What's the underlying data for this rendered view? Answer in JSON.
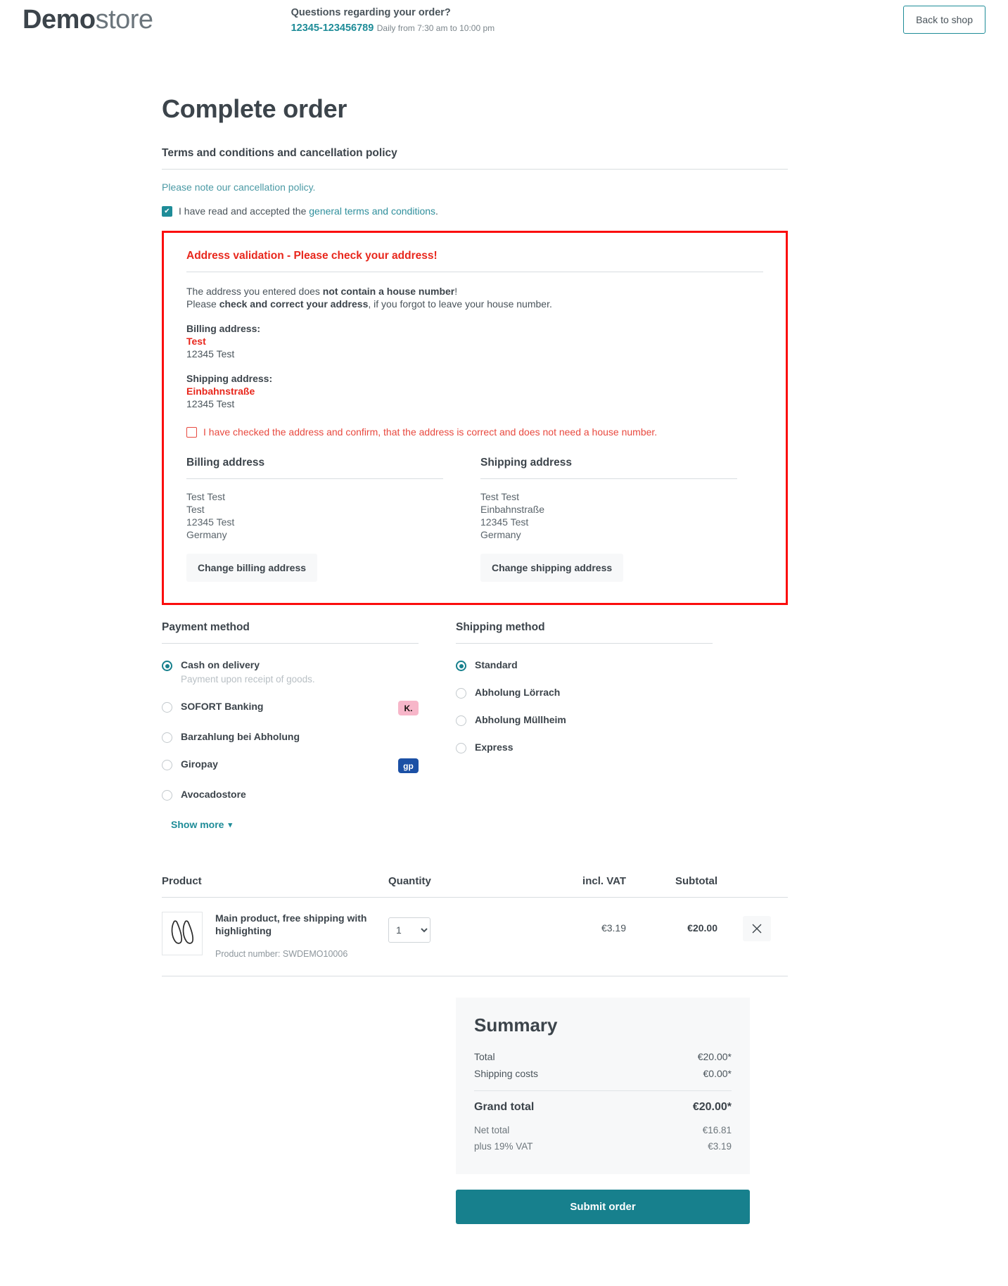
{
  "header": {
    "logo_bold": "Demo",
    "logo_light": "store",
    "question": "Questions regarding your order?",
    "phone": "12345-123456789",
    "hours": "Daily from 7:30 am to 10:00 pm",
    "back_to_shop": "Back to shop"
  },
  "page": {
    "title": "Complete order"
  },
  "terms": {
    "heading": "Terms and conditions and cancellation policy",
    "cancellation_note": "Please note our cancellation policy.",
    "accept_prefix": "I have read and accepted the ",
    "accept_link": "general terms and conditions",
    "accept_suffix": ".",
    "accepted": true
  },
  "validation": {
    "title": "Address validation - Please check your address!",
    "line1_a": "The address you entered does ",
    "line1_b": "not contain a house number",
    "line1_c": "!",
    "line2_a": "Please ",
    "line2_b": "check and correct your address",
    "line2_c": ", if you forgot to leave your house number.",
    "billing_label": "Billing address:",
    "billing_bad": "Test",
    "billing_city": "12345 Test",
    "shipping_label": "Shipping address:",
    "shipping_bad": "Einbahnstraße",
    "shipping_city": "12345 Test",
    "confirm_label": "I have checked the address and confirm, that the address is correct and does not need a house number.",
    "confirm_checked": false,
    "border_color": "#fb0d0d",
    "title_color": "#e8271c"
  },
  "addresses": {
    "billing": {
      "heading": "Billing address",
      "lines": [
        "Test Test",
        "Test",
        "12345 Test",
        "Germany"
      ],
      "change_button": "Change billing address"
    },
    "shipping": {
      "heading": "Shipping address",
      "lines": [
        "Test Test",
        "Einbahnstraße",
        "12345 Test",
        "Germany"
      ],
      "change_button": "Change shipping address"
    }
  },
  "payment": {
    "heading": "Payment method",
    "options": [
      {
        "label": "Cash on delivery",
        "desc": "Payment upon receipt of goods.",
        "selected": true,
        "badge": null
      },
      {
        "label": "SOFORT Banking",
        "desc": "",
        "selected": false,
        "badge": {
          "text": "K.",
          "kind": "klarna"
        }
      },
      {
        "label": "Barzahlung bei Abholung",
        "desc": "",
        "selected": false,
        "badge": null
      },
      {
        "label": "Giropay",
        "desc": "",
        "selected": false,
        "badge": {
          "text": "gp",
          "kind": "giropay"
        }
      },
      {
        "label": "Avocadostore",
        "desc": "",
        "selected": false,
        "badge": null
      }
    ],
    "show_more": "Show more",
    "show_more_icon": "chevron-down-icon"
  },
  "shipping_method": {
    "heading": "Shipping method",
    "options": [
      {
        "label": "Standard",
        "selected": true
      },
      {
        "label": "Abholung Lörrach",
        "selected": false
      },
      {
        "label": "Abholung Müllheim",
        "selected": false
      },
      {
        "label": "Express",
        "selected": false
      }
    ]
  },
  "cart": {
    "columns": {
      "product": "Product",
      "quantity": "Quantity",
      "vat": "incl. VAT",
      "subtotal": "Subtotal"
    },
    "items": [
      {
        "name": "Main product, free shipping with highlighting",
        "product_number": "Product number: SWDEMO10006",
        "quantity": "1",
        "vat": "€3.19",
        "subtotal": "€20.00",
        "remove_icon": "close-icon",
        "thumb_icon": "shoes-icon"
      }
    ]
  },
  "summary": {
    "title": "Summary",
    "rows": [
      {
        "label": "Total",
        "value": "€20.00*"
      },
      {
        "label": "Shipping costs",
        "value": "€0.00*"
      }
    ],
    "grand_label": "Grand total",
    "grand_value": "€20.00*",
    "small_rows": [
      {
        "label": "Net total",
        "value": "€16.81"
      },
      {
        "label": "plus 19% VAT",
        "value": "€3.19"
      }
    ],
    "submit": "Submit order",
    "accent": "#17808d"
  }
}
